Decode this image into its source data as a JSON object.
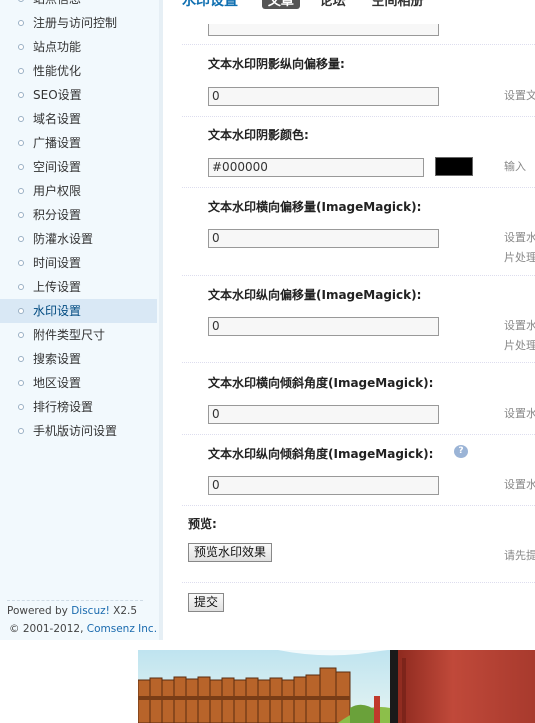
{
  "sidebar": {
    "items": [
      {
        "label": "站点信息"
      },
      {
        "label": "注册与访问控制"
      },
      {
        "label": "站点功能"
      },
      {
        "label": "性能优化"
      },
      {
        "label": "SEO设置"
      },
      {
        "label": "域名设置"
      },
      {
        "label": "广播设置"
      },
      {
        "label": "空间设置"
      },
      {
        "label": "用户权限"
      },
      {
        "label": "积分设置"
      },
      {
        "label": "防灌水设置"
      },
      {
        "label": "时间设置"
      },
      {
        "label": "上传设置"
      },
      {
        "label": "水印设置"
      },
      {
        "label": "附件类型尺寸"
      },
      {
        "label": "搜索设置"
      },
      {
        "label": "地区设置"
      },
      {
        "label": "排行榜设置"
      },
      {
        "label": "手机版访问设置"
      }
    ],
    "active_index": 13,
    "powered_prefix": "Powered by ",
    "powered_brand": "Discuz!",
    "powered_version": " X2.5",
    "copyright_prefix": "© 2001-2012, ",
    "copyright_company": "Comsenz Inc."
  },
  "header": {
    "title": "水印设置",
    "tabs": [
      "文章",
      "论坛",
      "空间相册"
    ]
  },
  "form": {
    "shadow_y_offset": {
      "label": "文本水印阴影纵向偏移量:",
      "value": "0",
      "tip": "设置文"
    },
    "shadow_color": {
      "label": "文本水印阴影颜色:",
      "value": "#000000",
      "tip": "输入",
      "swatch_color": "#000000"
    },
    "x_offset": {
      "label": "文本水印横向偏移量(ImageMagick):",
      "value": "0",
      "tip1": "设置水",
      "tip2": "片处理"
    },
    "y_offset": {
      "label": "文本水印纵向偏移量(ImageMagick):",
      "value": "0",
      "tip1": "设置水",
      "tip2": "片处理"
    },
    "x_skew": {
      "label": "文本水印横向倾斜角度(ImageMagick):",
      "value": "0",
      "tip": "设置水"
    },
    "y_skew": {
      "label": "文本水印纵向倾斜角度(ImageMagick):",
      "value": "0",
      "tip": "设置水",
      "help_icon": "?"
    },
    "preview": {
      "label": "预览:",
      "button": "预览水印效果",
      "tip": "请先提"
    },
    "submit_button": "提交"
  },
  "colors": {
    "accent": "#0f6fb1",
    "sidebar_bg": "#f2f9fd",
    "active_item_bg": "#d9e8f5"
  }
}
